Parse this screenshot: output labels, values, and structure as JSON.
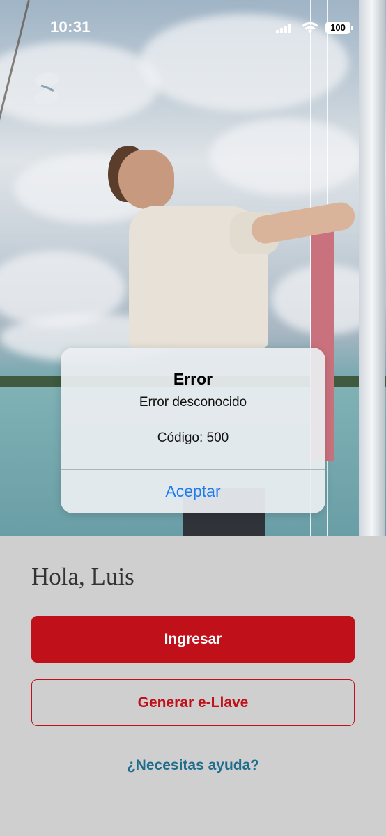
{
  "status_bar": {
    "time": "10:31",
    "battery": "100",
    "icons": [
      "signal-icon",
      "wifi-icon",
      "battery-icon"
    ]
  },
  "brand": {
    "logo_icon": "bank-logo-icon",
    "accent_color": "#c0111a",
    "link_color": "#1f6d8c"
  },
  "main": {
    "greeting": "Hola, Luis",
    "primary_button": "Ingresar",
    "secondary_button": "Generar e-Llave",
    "help_link": "¿Necesitas ayuda?"
  },
  "alert": {
    "title": "Error",
    "message": "Error desconocido",
    "code": "Código: 500",
    "button": "Aceptar"
  }
}
